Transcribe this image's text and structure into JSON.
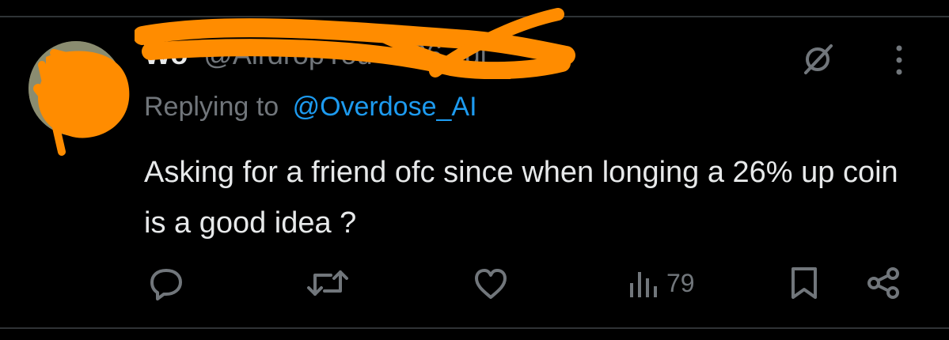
{
  "tweet": {
    "display_name": "Wo",
    "handle": "@AirdropYou",
    "separator": "·",
    "date": "06 Jul",
    "replying_prefix": "Replying to",
    "replying_to": "@Overdose_AI",
    "text": "Asking for a friend ofc since when longing a 26% up coin is a good idea ?",
    "views": "79"
  },
  "icons": {
    "grok": "grok-icon",
    "more": "more-dots-icon",
    "reply": "reply-icon",
    "retweet": "retweet-icon",
    "like": "heart-icon",
    "views": "bar-chart-icon",
    "bookmark": "bookmark-icon",
    "share": "share-icon"
  },
  "colors": {
    "background": "#000000",
    "text": "#e7e9ea",
    "muted": "#71767b",
    "link": "#1d9bf0",
    "redaction": "#ff8c00"
  }
}
